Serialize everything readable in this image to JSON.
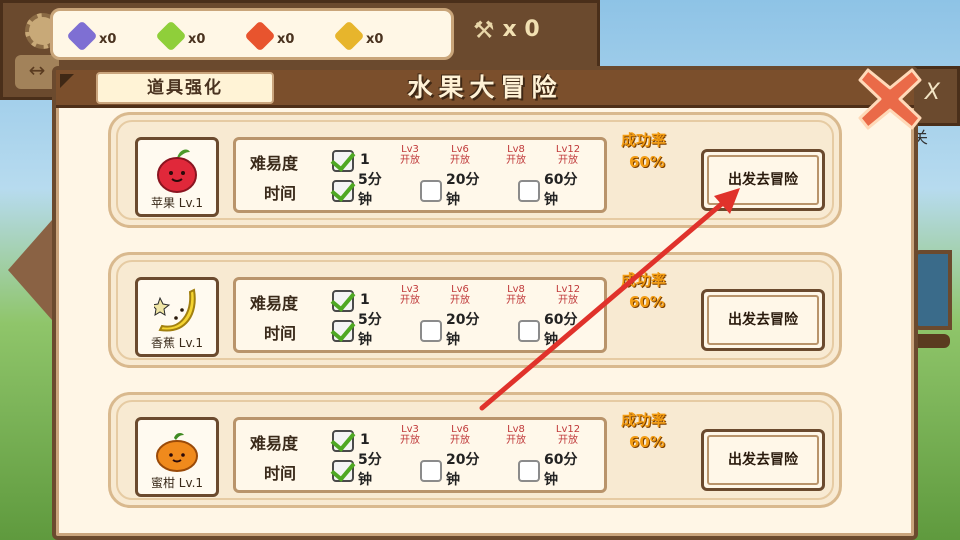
{
  "hud": {
    "resources": [
      {
        "icon": "purple-gem-icon",
        "color": "#7e6fd3",
        "count": "x0"
      },
      {
        "icon": "green-gem-icon",
        "color": "#8fcf3a",
        "count": "x0"
      },
      {
        "icon": "red-gem-icon",
        "color": "#e8542e",
        "count": "x0"
      },
      {
        "icon": "gold-gem-icon",
        "color": "#e7b52c",
        "count": "x0"
      }
    ],
    "tool_count": "x 0",
    "right_x": "X",
    "right_text": "关"
  },
  "dialog": {
    "tab_upgrade": "道具强化",
    "title": "水果大冒险"
  },
  "rows": [
    {
      "fruit_name": "苹果 Lv.1",
      "difficulty_label": "难易度",
      "time_label": "时间",
      "difficulty_value": "1",
      "slots": [
        {
          "lock_lv": "",
          "lock_text": "",
          "time": "5分钟",
          "checked": true
        },
        {
          "lock_lv": "Lv3",
          "lock_text": "开放",
          "time": "20分钟",
          "checked": false
        },
        {
          "lock_lv": "Lv6",
          "lock_text": "开放",
          "time": "",
          "checked": false
        },
        {
          "lock_lv": "Lv8",
          "lock_text": "开放",
          "time": "60分钟",
          "checked": false
        },
        {
          "lock_lv": "Lv12",
          "lock_text": "开放",
          "time": "",
          "checked": false
        }
      ],
      "rate_label": "成功率",
      "rate_value": "60%",
      "go_label": "出发去冒险"
    },
    {
      "fruit_name": "香蕉 Lv.1",
      "difficulty_label": "难易度",
      "time_label": "时间",
      "difficulty_value": "1",
      "slots": [
        {
          "lock_lv": "",
          "lock_text": "",
          "time": "5分钟",
          "checked": true
        },
        {
          "lock_lv": "Lv3",
          "lock_text": "开放",
          "time": "20分钟",
          "checked": false
        },
        {
          "lock_lv": "Lv6",
          "lock_text": "开放",
          "time": "",
          "checked": false
        },
        {
          "lock_lv": "Lv8",
          "lock_text": "开放",
          "time": "60分钟",
          "checked": false
        },
        {
          "lock_lv": "Lv12",
          "lock_text": "开放",
          "time": "",
          "checked": false
        }
      ],
      "rate_label": "成功率",
      "rate_value": "60%",
      "go_label": "出发去冒险"
    },
    {
      "fruit_name": "蜜柑 Lv.1",
      "difficulty_label": "难易度",
      "time_label": "时间",
      "difficulty_value": "1",
      "slots": [
        {
          "lock_lv": "",
          "lock_text": "",
          "time": "5分钟",
          "checked": true
        },
        {
          "lock_lv": "Lv3",
          "lock_text": "开放",
          "time": "20分钟",
          "checked": false
        },
        {
          "lock_lv": "Lv6",
          "lock_text": "开放",
          "time": "",
          "checked": false
        },
        {
          "lock_lv": "Lv8",
          "lock_text": "开放",
          "time": "60分钟",
          "checked": false
        },
        {
          "lock_lv": "Lv12",
          "lock_text": "开放",
          "time": "",
          "checked": false
        }
      ],
      "rate_label": "成功率",
      "rate_value": "60%",
      "go_label": "出发去冒险"
    }
  ],
  "colors": {
    "accent_rate": "#f39c12",
    "annotation_arrow": "#e0322b",
    "close_button": "#ea6a48"
  }
}
